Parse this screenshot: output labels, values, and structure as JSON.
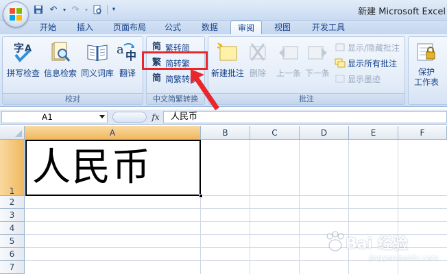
{
  "window": {
    "title": "新建 Microsoft Excel"
  },
  "tabs": [
    {
      "label": "开始",
      "active": false
    },
    {
      "label": "插入",
      "active": false
    },
    {
      "label": "页面布局",
      "active": false
    },
    {
      "label": "公式",
      "active": false
    },
    {
      "label": "数据",
      "active": false
    },
    {
      "label": "审阅",
      "active": true
    },
    {
      "label": "视图",
      "active": false
    },
    {
      "label": "开发工具",
      "active": false
    }
  ],
  "ribbon": {
    "proofing": {
      "label": "校对",
      "buttons": [
        {
          "label": "拼写检查",
          "icon": "spelling-icon"
        },
        {
          "label": "信息检索",
          "icon": "research-icon"
        },
        {
          "label": "同义词库",
          "icon": "thesaurus-icon"
        },
        {
          "label": "翻译",
          "icon": "translate-icon"
        }
      ]
    },
    "chinese_conversion": {
      "label": "中文简繁转换",
      "buttons": [
        {
          "label": "繁转简",
          "glyph": "简"
        },
        {
          "label": "简转繁",
          "glyph": "繁"
        },
        {
          "label": "简繁转换",
          "glyph": "简"
        }
      ]
    },
    "comments": {
      "label": "批注",
      "buttons": [
        {
          "label": "新建批注",
          "enabled": true
        },
        {
          "label": "删除",
          "enabled": false
        },
        {
          "label": "上一条",
          "enabled": false
        },
        {
          "label": "下一条",
          "enabled": false
        }
      ],
      "small": [
        {
          "label": "显示/隐藏批注",
          "enabled": false
        },
        {
          "label": "显示所有批注",
          "enabled": true
        },
        {
          "label": "显示墨迹",
          "enabled": false
        }
      ]
    },
    "changes": {
      "buttons": [
        {
          "label": "保护\n工作表"
        }
      ]
    }
  },
  "formula_bar": {
    "name_box": "A1",
    "fx_label": "fx",
    "content": "人民币"
  },
  "sheet": {
    "columns": [
      "A",
      "B",
      "C",
      "D",
      "E",
      "F"
    ],
    "rows": [
      "1",
      "2",
      "3",
      "4",
      "5",
      "6",
      "7"
    ],
    "selected_cell": "A1",
    "cell_a1": "人民币"
  },
  "watermark": {
    "text": "Bai 经验",
    "sub": "jingyan.baidu.com"
  },
  "colors": {
    "highlight": "#e8262b",
    "accent": "#15428b"
  }
}
